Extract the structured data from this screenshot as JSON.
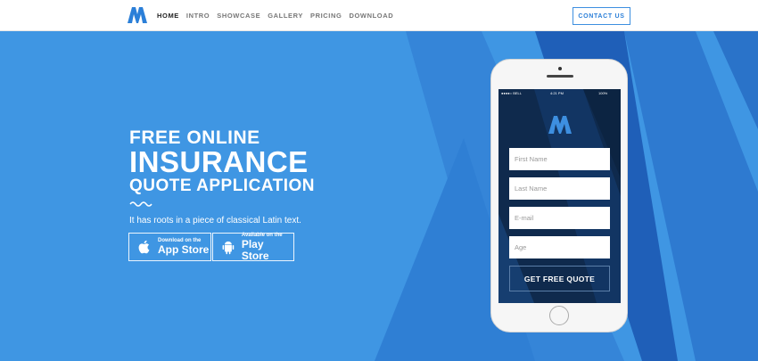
{
  "nav": {
    "items": [
      "HOME",
      "INTRO",
      "SHOWCASE",
      "GALLERY",
      "PRICING",
      "DOWNLOAD"
    ],
    "contact_label": "CONTACT US"
  },
  "hero": {
    "line1": "FREE ONLINE",
    "line2": "INSURANCE",
    "line3": "QUOTE APPLICATION",
    "tagline": "It has roots in a piece of classical Latin text.",
    "appstore": {
      "small": "Download on the",
      "big": "App Store"
    },
    "playstore": {
      "small": "Available on the",
      "big": "Play Store"
    }
  },
  "phone": {
    "status_carrier": "●●●●○ BELL",
    "status_time": "4:21 PM",
    "status_battery": "100%",
    "fields": [
      "First Name",
      "Last Name",
      "E-mail",
      "Age"
    ],
    "button_label": "GET FREE QUOTE"
  },
  "colors": {
    "accent": "#3d8fe0",
    "hero_bg": "#3f96e3",
    "screen_bg": "#0f2a4d"
  }
}
